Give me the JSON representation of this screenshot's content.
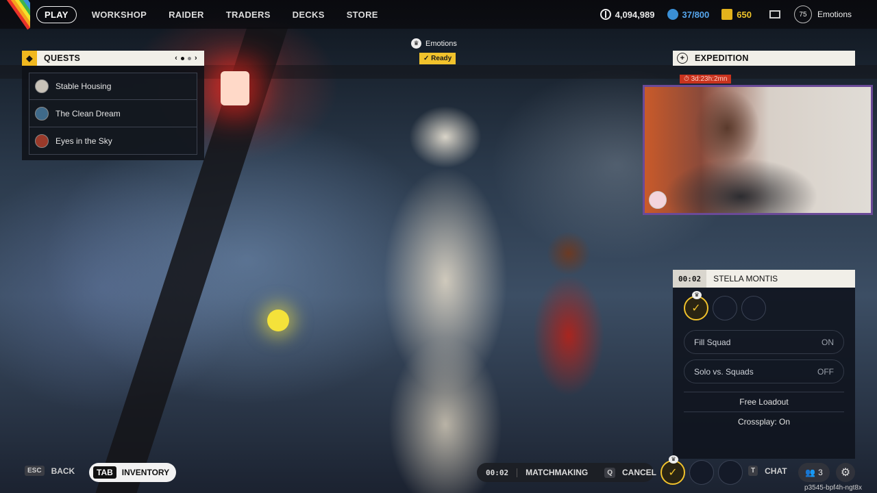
{
  "nav": {
    "items": [
      "PLAY",
      "WORKSHOP",
      "RAIDER",
      "TRADERS",
      "DECKS",
      "STORE"
    ],
    "active": "PLAY"
  },
  "stats": {
    "coins": "4,094,989",
    "credits": "37/800",
    "gold": "650",
    "level": "75",
    "username": "Emotions"
  },
  "quests": {
    "title": "QUESTS",
    "page_prev": "‹",
    "page_next": "›",
    "items": [
      "Stable Housing",
      "The Clean Dream",
      "Eyes in the Sky"
    ]
  },
  "lobby_player": {
    "name": "Emotions",
    "status": "Ready"
  },
  "expedition": {
    "title": "EXPEDITION",
    "timer": "3d:23h:2mn"
  },
  "squad": {
    "timer": "00:02",
    "map": "STELLA MONTIS",
    "fill_squad_label": "Fill Squad",
    "fill_squad_value": "ON",
    "solo_label": "Solo vs. Squads",
    "solo_value": "OFF",
    "free_loadout": "Free Loadout",
    "crossplay": "Crossplay: On"
  },
  "bottom": {
    "back_key": "ESC",
    "back_label": "BACK",
    "inventory_key": "TAB",
    "inventory_label": "INVENTORY",
    "mm_time": "00:02",
    "mm_label": "MATCHMAKING",
    "cancel_key": "Q",
    "cancel_label": "CANCEL",
    "chat_key": "T",
    "chat_label": "CHAT",
    "party_count": "3",
    "session_id": "p3545-bpf4h-ngt8x"
  },
  "colors": {
    "accent_yellow": "#f1c22c",
    "credits_blue": "#56a6ee",
    "gold": "#f0c52a",
    "expedition_timer_red": "#c9331e",
    "webcam_border": "#6b4a98"
  },
  "icons": [
    "coin-icon",
    "credits-icon",
    "gold-icon",
    "mail-icon",
    "level-badge",
    "quest-icon",
    "expedition-icon",
    "crown-icon",
    "check-icon",
    "party-icon",
    "settings-icon"
  ]
}
